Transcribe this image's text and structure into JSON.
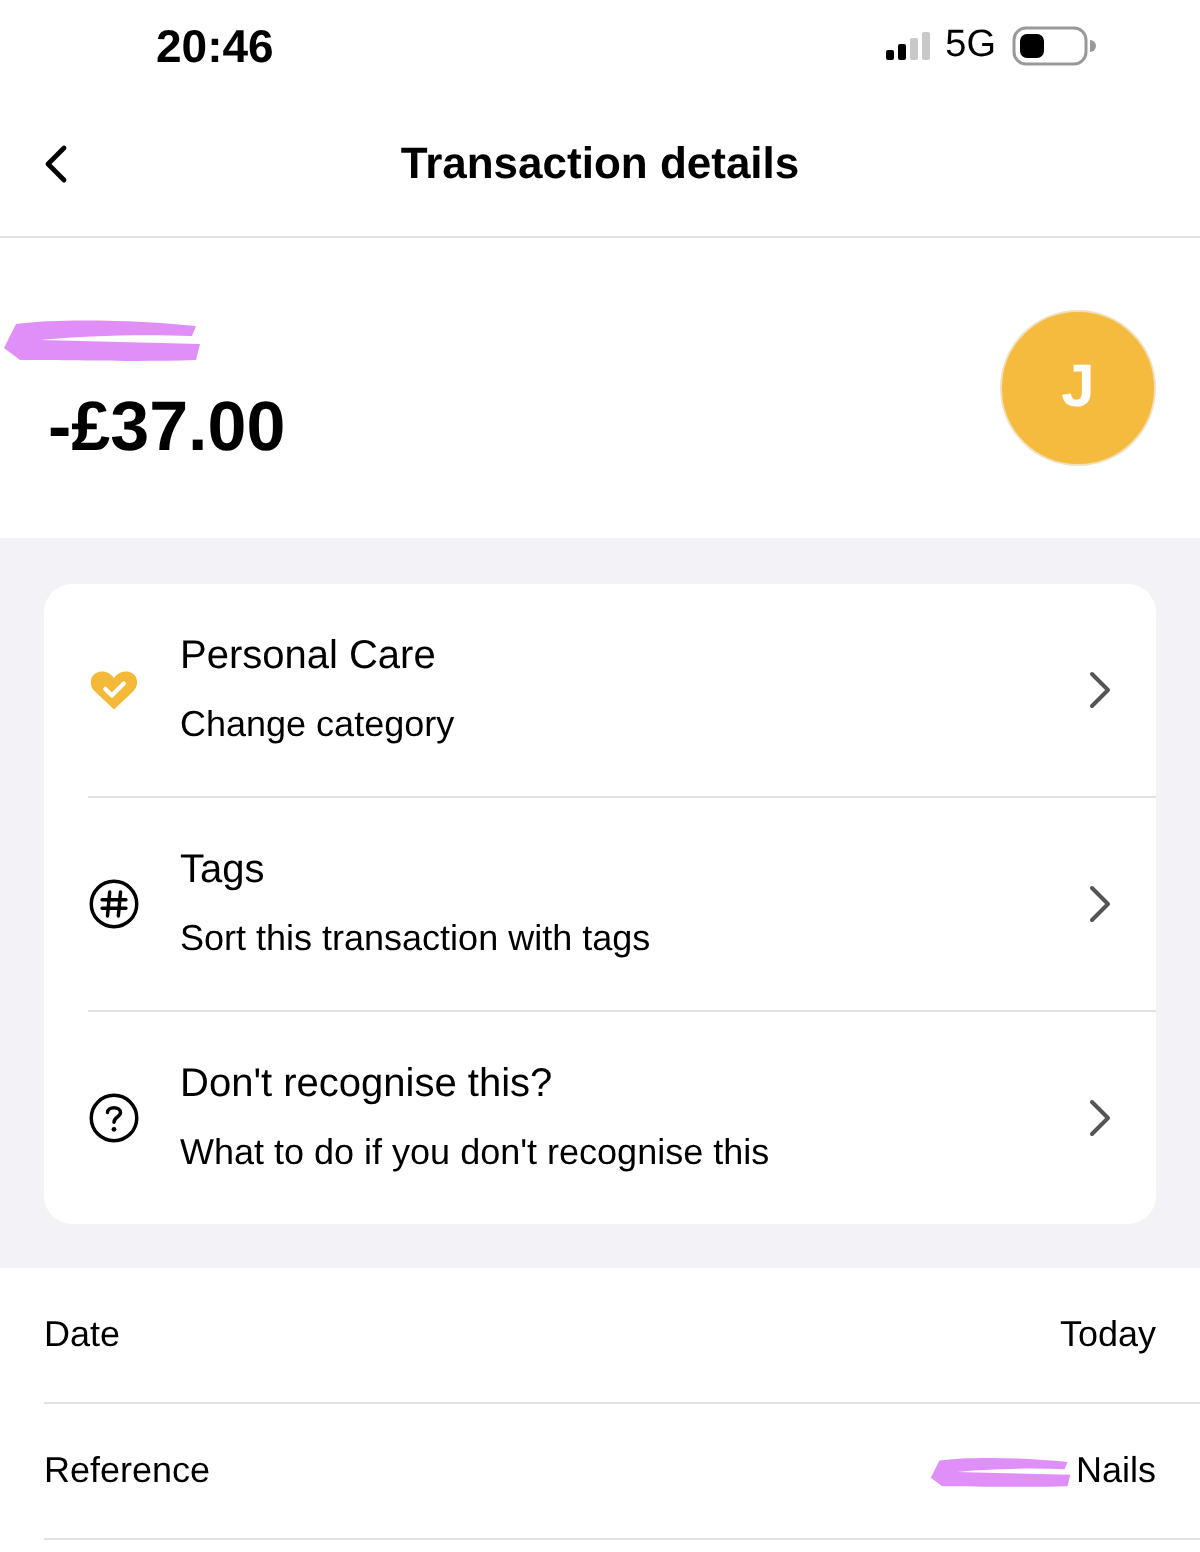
{
  "status_bar": {
    "time": "20:46",
    "network": "5G"
  },
  "header": {
    "title": "Transaction details"
  },
  "summary": {
    "amount": "-£37.00",
    "avatar_initial": "J",
    "merchant_redacted": true
  },
  "actions": [
    {
      "kind": "category",
      "title": "Personal Care",
      "subtitle": "Change category"
    },
    {
      "kind": "tags",
      "title": "Tags",
      "subtitle": "Sort this transaction with tags"
    },
    {
      "kind": "help",
      "title": "Don't recognise this?",
      "subtitle": "What to do if you don't recognise this"
    }
  ],
  "details": [
    {
      "label": "Date",
      "value": "Today",
      "redacted": false
    },
    {
      "label": "Reference",
      "value": "Nails",
      "redacted": true
    }
  ]
}
